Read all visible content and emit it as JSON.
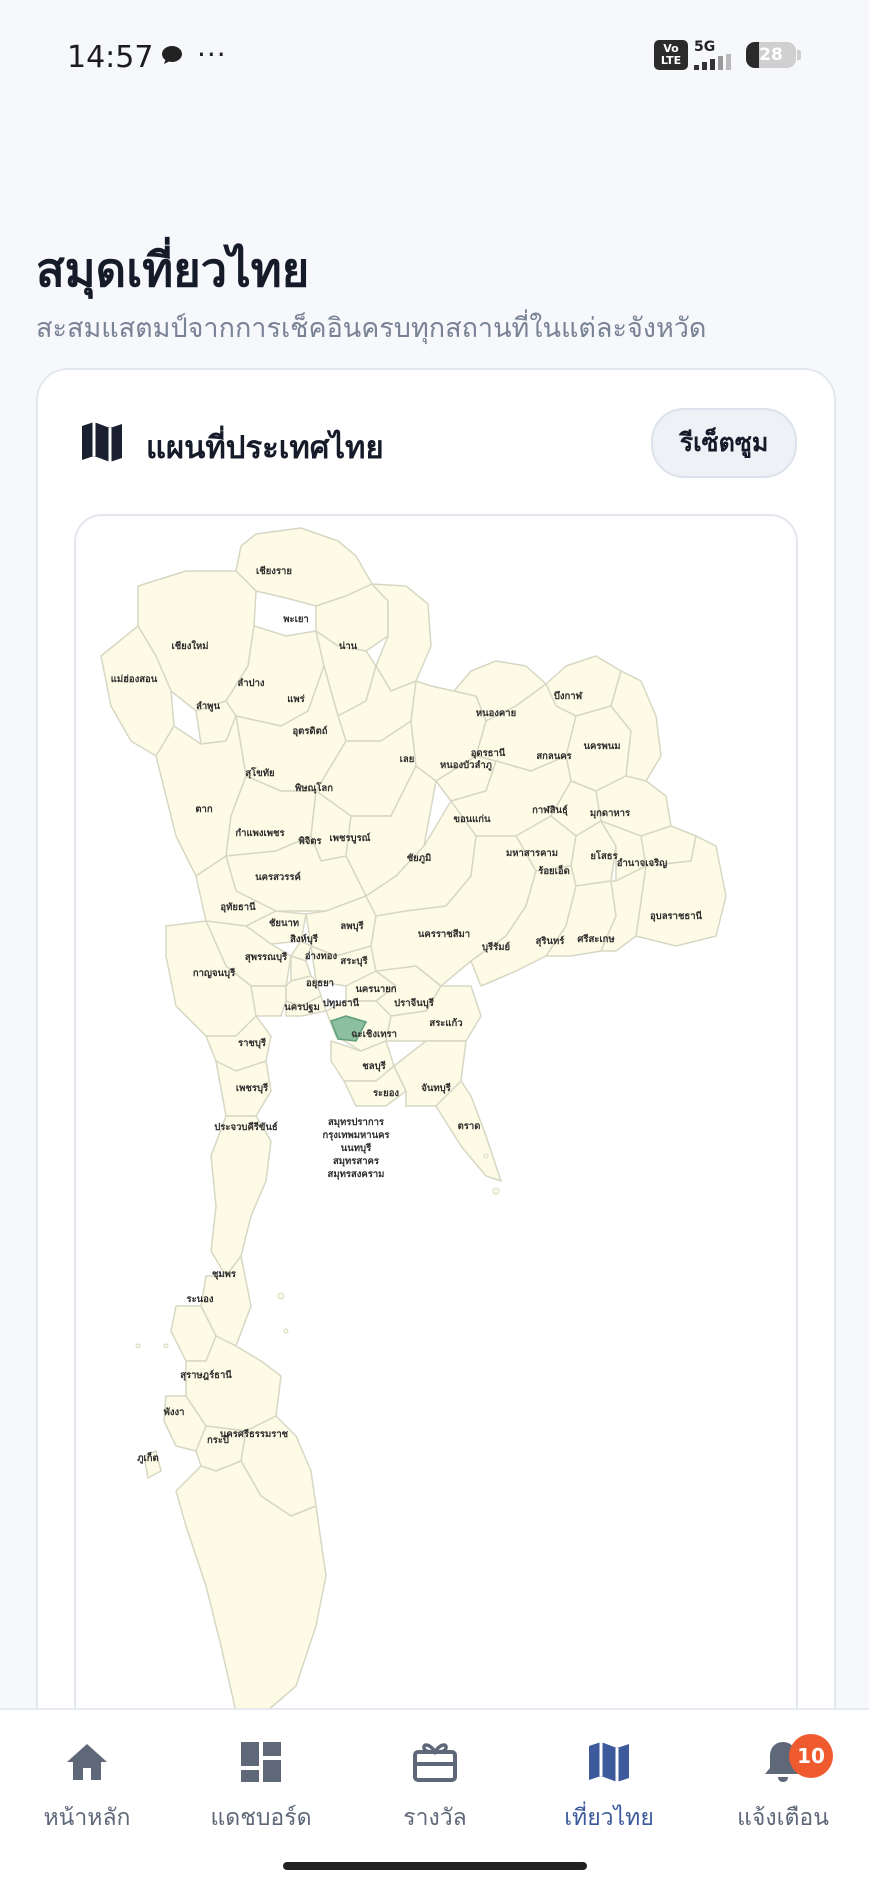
{
  "status_bar": {
    "time": "14:57",
    "network_badge": "Vo LTE",
    "network_type": "5G",
    "battery_level": "28"
  },
  "page": {
    "title": "สมุดเที่ยวไทย",
    "subtitle": "สะสมแสตมป์จากการเช็คอินครบทุกสถานที่ในแต่ละจังหวัด"
  },
  "map_card": {
    "title": "แผนที่ประเทศไทย",
    "reset_button": "รีเซ็ตซูม",
    "icon": "map-icon",
    "colors": {
      "province_fill": "#fdfbe6",
      "province_border": "#d6d8c4",
      "highlight_fill": "#8bbf9f"
    },
    "provinces": [
      "เชียงราย",
      "พะเยา",
      "เชียงใหม่",
      "น่าน",
      "แม่ฮ่องสอน",
      "ลำปาง",
      "ลำพูน",
      "แพร่",
      "อุตรดิตถ์",
      "สุโขทัย",
      "พิษณุโลก",
      "ตาก",
      "กำแพงเพชร",
      "พิจิตร",
      "เพชรบูรณ์",
      "นครสวรรค์",
      "อุทัยธานี",
      "ชัยนาท",
      "ลพบุรี",
      "สิงห์บุรี",
      "สุพรรณบุรี",
      "อ่างทอง",
      "สระบุรี",
      "กาญจนบุรี",
      "อยุธยา",
      "นครนายก",
      "นครปฐม",
      "ปทุมธานี",
      "ปราจีนบุรี",
      "ราชบุรี",
      "ฉะเชิงเทรา",
      "สระแก้ว",
      "ชลบุรี",
      "เพชรบุรี",
      "ระยอง",
      "จันทบุรี",
      "ประจวบคีรีขันธ์",
      "ตราด",
      "สมุทรปราการ",
      "กรุงเทพมหานคร",
      "นนทบุรี",
      "สมุทรสาคร",
      "สมุทรสงคราม",
      "บึงกาฬ",
      "หนองคาย",
      "อุดรธานี",
      "สกลนคร",
      "นครพนม",
      "เลย",
      "หนองบัวลำภู",
      "กาฬสินธุ์",
      "มุกดาหาร",
      "ขอนแก่น",
      "มหาสารคาม",
      "ยโสธร",
      "ชัยภูมิ",
      "ร้อยเอ็ด",
      "อำนาจเจริญ",
      "อุบลราชธานี",
      "นครราชสีมา",
      "บุรีรัมย์",
      "สุรินทร์",
      "ศรีสะเกษ",
      "ชุมพร",
      "ระนอง",
      "สุราษฎร์ธานี",
      "พังงา",
      "นครศรีธรรมราช",
      "กระบี่",
      "ภูเก็ต"
    ]
  },
  "bottom_nav": {
    "items": [
      {
        "label": "หน้าหลัก",
        "icon": "home-icon"
      },
      {
        "label": "แดชบอร์ด",
        "icon": "dashboard-icon"
      },
      {
        "label": "รางวัล",
        "icon": "gift-icon"
      },
      {
        "label": "เที่ยวไทย",
        "icon": "map-icon",
        "active": true
      },
      {
        "label": "แจ้งเตือน",
        "icon": "bell-icon"
      }
    ],
    "notification_count": "10",
    "active_color": "#3d5a9c",
    "badge_color": "#ef5a2f"
  }
}
